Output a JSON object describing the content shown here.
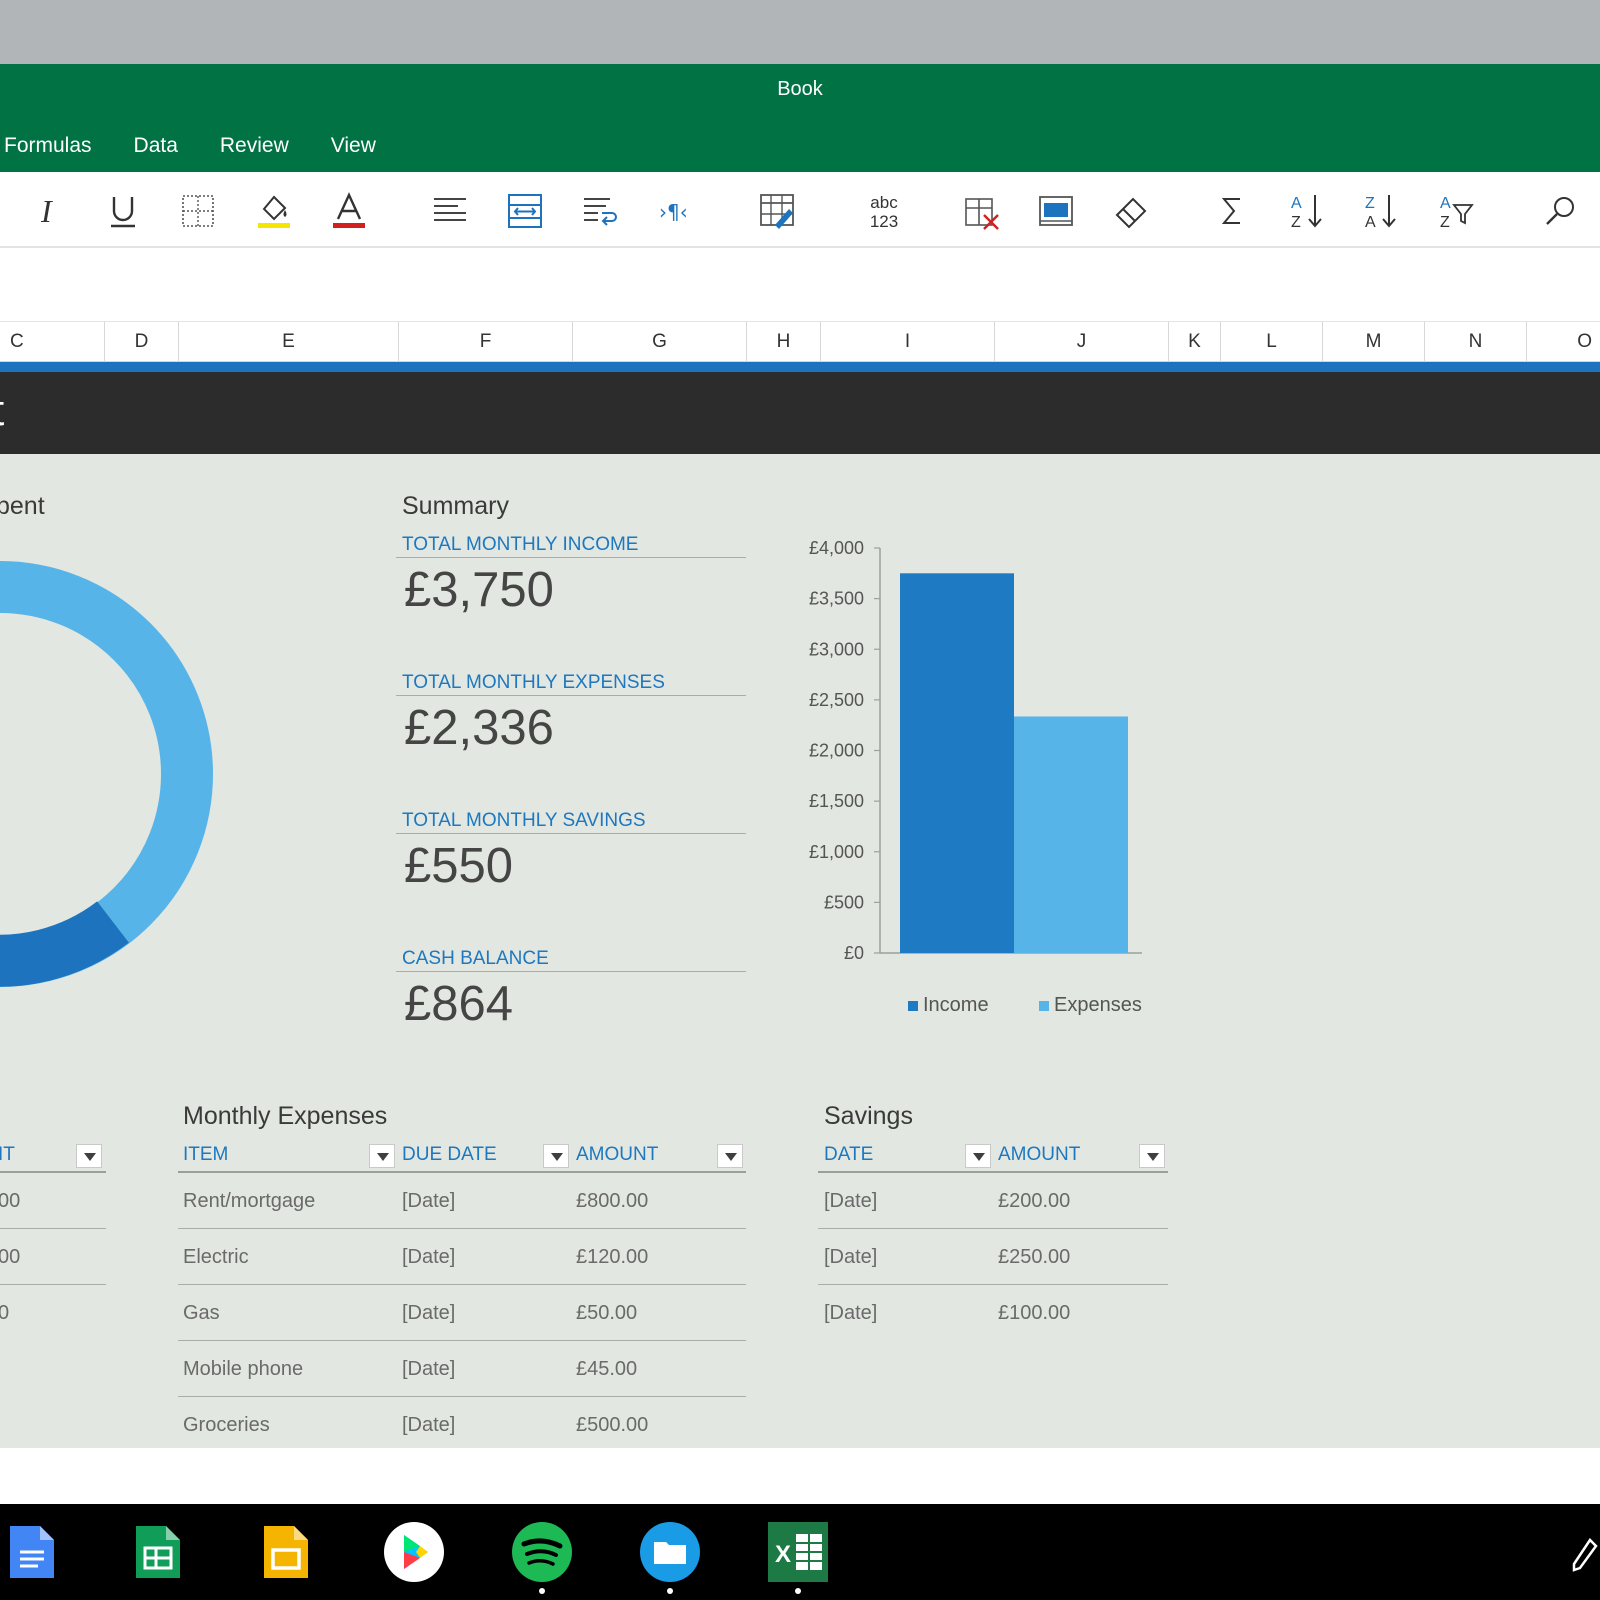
{
  "window": {
    "title": "Book"
  },
  "menu": [
    "Formulas",
    "Data",
    "Review",
    "View"
  ],
  "toolbar": [
    {
      "name": "italic-icon"
    },
    {
      "name": "underline-icon"
    },
    {
      "name": "borders-icon"
    },
    {
      "name": "fill-color-icon",
      "color": "#f5e500"
    },
    {
      "name": "font-color-icon",
      "color": "#d21f1f"
    },
    {
      "name": "align-left-icon"
    },
    {
      "name": "merge-center-icon"
    },
    {
      "name": "wrap-text-icon"
    },
    {
      "name": "text-direction-icon"
    },
    {
      "name": "format-as-table-icon"
    },
    {
      "name": "number-format-icon",
      "text_top": "abc",
      "text_bottom": "123"
    },
    {
      "name": "delete-cells-icon"
    },
    {
      "name": "freeze-panes-icon"
    },
    {
      "name": "clear-icon"
    },
    {
      "name": "autosum-icon"
    },
    {
      "name": "sort-ascending-icon"
    },
    {
      "name": "sort-descending-icon"
    },
    {
      "name": "filter-icon"
    },
    {
      "name": "search-icon"
    }
  ],
  "columns": [
    "C",
    "D",
    "E",
    "F",
    "G",
    "H",
    "I",
    "J",
    "K",
    "L",
    "M",
    "N",
    "O"
  ],
  "band": {
    "partial_title": "t"
  },
  "left_section": {
    "partial_heading": "pent",
    "partial_percent": "%"
  },
  "summary": {
    "heading": "Summary",
    "items": [
      {
        "label": "TOTAL MONTHLY INCOME",
        "value": "£3,750"
      },
      {
        "label": "TOTAL MONTHLY EXPENSES",
        "value": "£2,336"
      },
      {
        "label": "TOTAL MONTHLY SAVINGS",
        "value": "£550"
      },
      {
        "label": "CASH BALANCE",
        "value": "£864"
      }
    ]
  },
  "chart_data": {
    "type": "bar",
    "categories": [
      ""
    ],
    "series": [
      {
        "name": "Income",
        "values": [
          3750
        ],
        "color": "#1e7bc3"
      },
      {
        "name": "Expenses",
        "values": [
          2336
        ],
        "color": "#56b4e9"
      }
    ],
    "ylim": [
      0,
      4000
    ],
    "y_ticks": [
      "£0",
      "£500",
      "£1,000",
      "£1,500",
      "£2,000",
      "£2,500",
      "£3,000",
      "£3,500",
      "£4,000"
    ],
    "y_tick_values": [
      0,
      500,
      1000,
      1500,
      2000,
      2500,
      3000,
      3500,
      4000
    ],
    "legend": "bottom"
  },
  "donut": {
    "colors": [
      "#56b4e9",
      "#1e73be"
    ]
  },
  "left_table": {
    "partial_header": "IT",
    "partial_cells": [
      "00",
      "00",
      "0"
    ]
  },
  "expenses": {
    "title": "Monthly Expenses",
    "headers": [
      "ITEM",
      "DUE DATE",
      "AMOUNT"
    ],
    "rows": [
      [
        "Rent/mortgage",
        "[Date]",
        "£800.00"
      ],
      [
        "Electric",
        "[Date]",
        "£120.00"
      ],
      [
        "Gas",
        "[Date]",
        "£50.00"
      ],
      [
        "Mobile phone",
        "[Date]",
        "£45.00"
      ],
      [
        "Groceries",
        "[Date]",
        "£500.00"
      ]
    ]
  },
  "savings": {
    "title": "Savings",
    "headers": [
      "DATE",
      "AMOUNT"
    ],
    "rows": [
      [
        "[Date]",
        "£200.00"
      ],
      [
        "[Date]",
        "£250.00"
      ],
      [
        "[Date]",
        "£100.00"
      ]
    ]
  },
  "taskbar": [
    {
      "name": "google-docs-icon",
      "color": "#4285f4"
    },
    {
      "name": "google-sheets-icon",
      "color": "#0f9d58"
    },
    {
      "name": "google-slides-icon",
      "color": "#f4b400"
    },
    {
      "name": "play-store-icon",
      "color": "#ffffff"
    },
    {
      "name": "spotify-icon",
      "color": "#1db954"
    },
    {
      "name": "files-icon",
      "color": "#1a9be6"
    },
    {
      "name": "excel-icon",
      "color": "#1d7a45"
    },
    {
      "name": "stylus-icon",
      "color": "#ffffff"
    }
  ]
}
